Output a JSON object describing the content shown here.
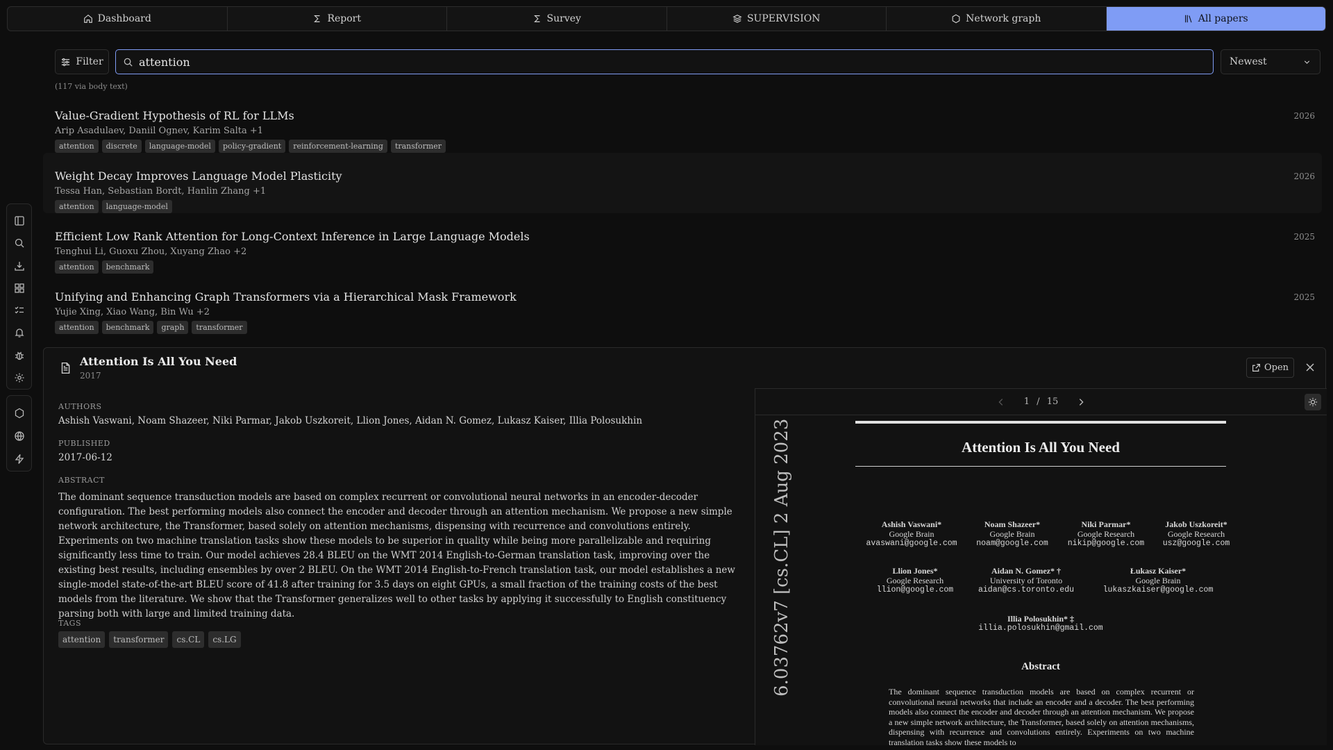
{
  "nav": {
    "tabs": [
      {
        "label": "Dashboard",
        "icon": "home-icon"
      },
      {
        "label": "Report",
        "icon": "sigma-icon"
      },
      {
        "label": "Survey",
        "icon": "sigma-icon"
      },
      {
        "label": "SUPERVISION",
        "icon": "layers-icon"
      },
      {
        "label": "Network graph",
        "icon": "hexagon-icon"
      },
      {
        "label": "All papers",
        "icon": "library-icon",
        "active": true
      }
    ]
  },
  "toolbar": {
    "filter_label": "Filter",
    "search_value": "attention",
    "sort_value": "Newest",
    "hint": "(117 via body text)"
  },
  "papers": [
    {
      "title": "Value-Gradient Hypothesis of RL for LLMs",
      "authors": "Arip Asadulaev, Daniil Ognev, Karim Salta +1",
      "year": "2026",
      "tags": [
        "attention",
        "discrete",
        "language-model",
        "policy-gradient",
        "reinforcement-learning",
        "transformer"
      ]
    },
    {
      "title": "Weight Decay Improves Language Model Plasticity",
      "authors": "Tessa Han, Sebastian Bordt, Hanlin Zhang +1",
      "year": "2026",
      "tags": [
        "attention",
        "language-model"
      ]
    },
    {
      "title": "Efficient Low Rank Attention for Long-Context Inference in Large Language Models",
      "authors": "Tenghui Li, Guoxu Zhou, Xuyang Zhao +2",
      "year": "2025",
      "tags": [
        "attention",
        "benchmark"
      ]
    },
    {
      "title": "Unifying and Enhancing Graph Transformers via a Hierarchical Mask Framework",
      "authors": "Yujie Xing, Xiao Wang, Bin Wu +2",
      "year": "2025",
      "tags": [
        "attention",
        "benchmark",
        "graph",
        "transformer"
      ]
    }
  ],
  "detail": {
    "title": "Attention Is All You Need",
    "year": "2017",
    "open_label": "Open",
    "authors_label": "AUTHORS",
    "authors": "Ashish Vaswani, Noam Shazeer, Niki Parmar, Jakob Uszkoreit, Llion Jones, Aidan N. Gomez, Lukasz Kaiser, Illia Polosukhin",
    "published_label": "PUBLISHED",
    "published": "2017-06-12",
    "abstract_label": "ABSTRACT",
    "abstract": "The dominant sequence transduction models are based on complex recurrent or convolutional neural networks in an encoder-decoder configuration. The best performing models also connect the encoder and decoder through an attention mechanism. We propose a new simple network architecture, the Transformer, based solely on attention mechanisms, dispensing with recurrence and convolutions entirely. Experiments on two machine translation tasks show these models to be superior in quality while being more parallelizable and requiring significantly less time to train. Our model achieves 28.4 BLEU on the WMT 2014 English-to-German translation task, improving over the existing best results, including ensembles by over 2 BLEU. On the WMT 2014 English-to-French translation task, our model establishes a new single-model state-of-the-art BLEU score of 41.8 after training for 3.5 days on eight GPUs, a small fraction of the training costs of the best models from the literature. We show that the Transformer generalizes well to other tasks by applying it successfully to English constituency parsing both with large and limited training data.",
    "tags_label": "TAGS",
    "tags": [
      "attention",
      "transformer",
      "cs.CL",
      "cs.LG"
    ]
  },
  "viewer": {
    "page_current": "1",
    "page_sep": "/",
    "page_total": "15",
    "pdf": {
      "arxiv_stamp": "6.03762v7  [cs.CL]  2 Aug 2023",
      "title": "Attention Is All You Need",
      "authors": [
        {
          "name": "Ashish Vaswani*",
          "affil": "Google Brain",
          "email": "avaswani@google.com"
        },
        {
          "name": "Noam Shazeer*",
          "affil": "Google Brain",
          "email": "noam@google.com"
        },
        {
          "name": "Niki Parmar*",
          "affil": "Google Research",
          "email": "nikip@google.com"
        },
        {
          "name": "Jakob Uszkoreit*",
          "affil": "Google Research",
          "email": "usz@google.com"
        },
        {
          "name": "Llion Jones*",
          "affil": "Google Research",
          "email": "llion@google.com"
        },
        {
          "name": "Aidan N. Gomez* †",
          "affil": "University of Toronto",
          "email": "aidan@cs.toronto.edu"
        },
        {
          "name": "Łukasz Kaiser*",
          "affil": "Google Brain",
          "email": "lukaszkaiser@google.com"
        },
        {
          "name": "Illia Polosukhin* ‡",
          "affil": "",
          "email": "illia.polosukhin@gmail.com"
        }
      ],
      "abstract_heading": "Abstract",
      "abstract_text": "The dominant sequence transduction models are based on complex recurrent or convolutional neural networks that include an encoder and a decoder. The best performing models also connect the encoder and decoder through an attention mechanism. We propose a new simple network architecture, the Transformer, based solely on attention mechanisms, dispensing with recurrence and convolutions entirely. Experiments on two machine translation tasks show these models to"
    }
  },
  "colors": {
    "accent": "#7f9cf5",
    "background": "#0e0e0e",
    "panel": "#121212",
    "tag": "#2d2d2d"
  }
}
